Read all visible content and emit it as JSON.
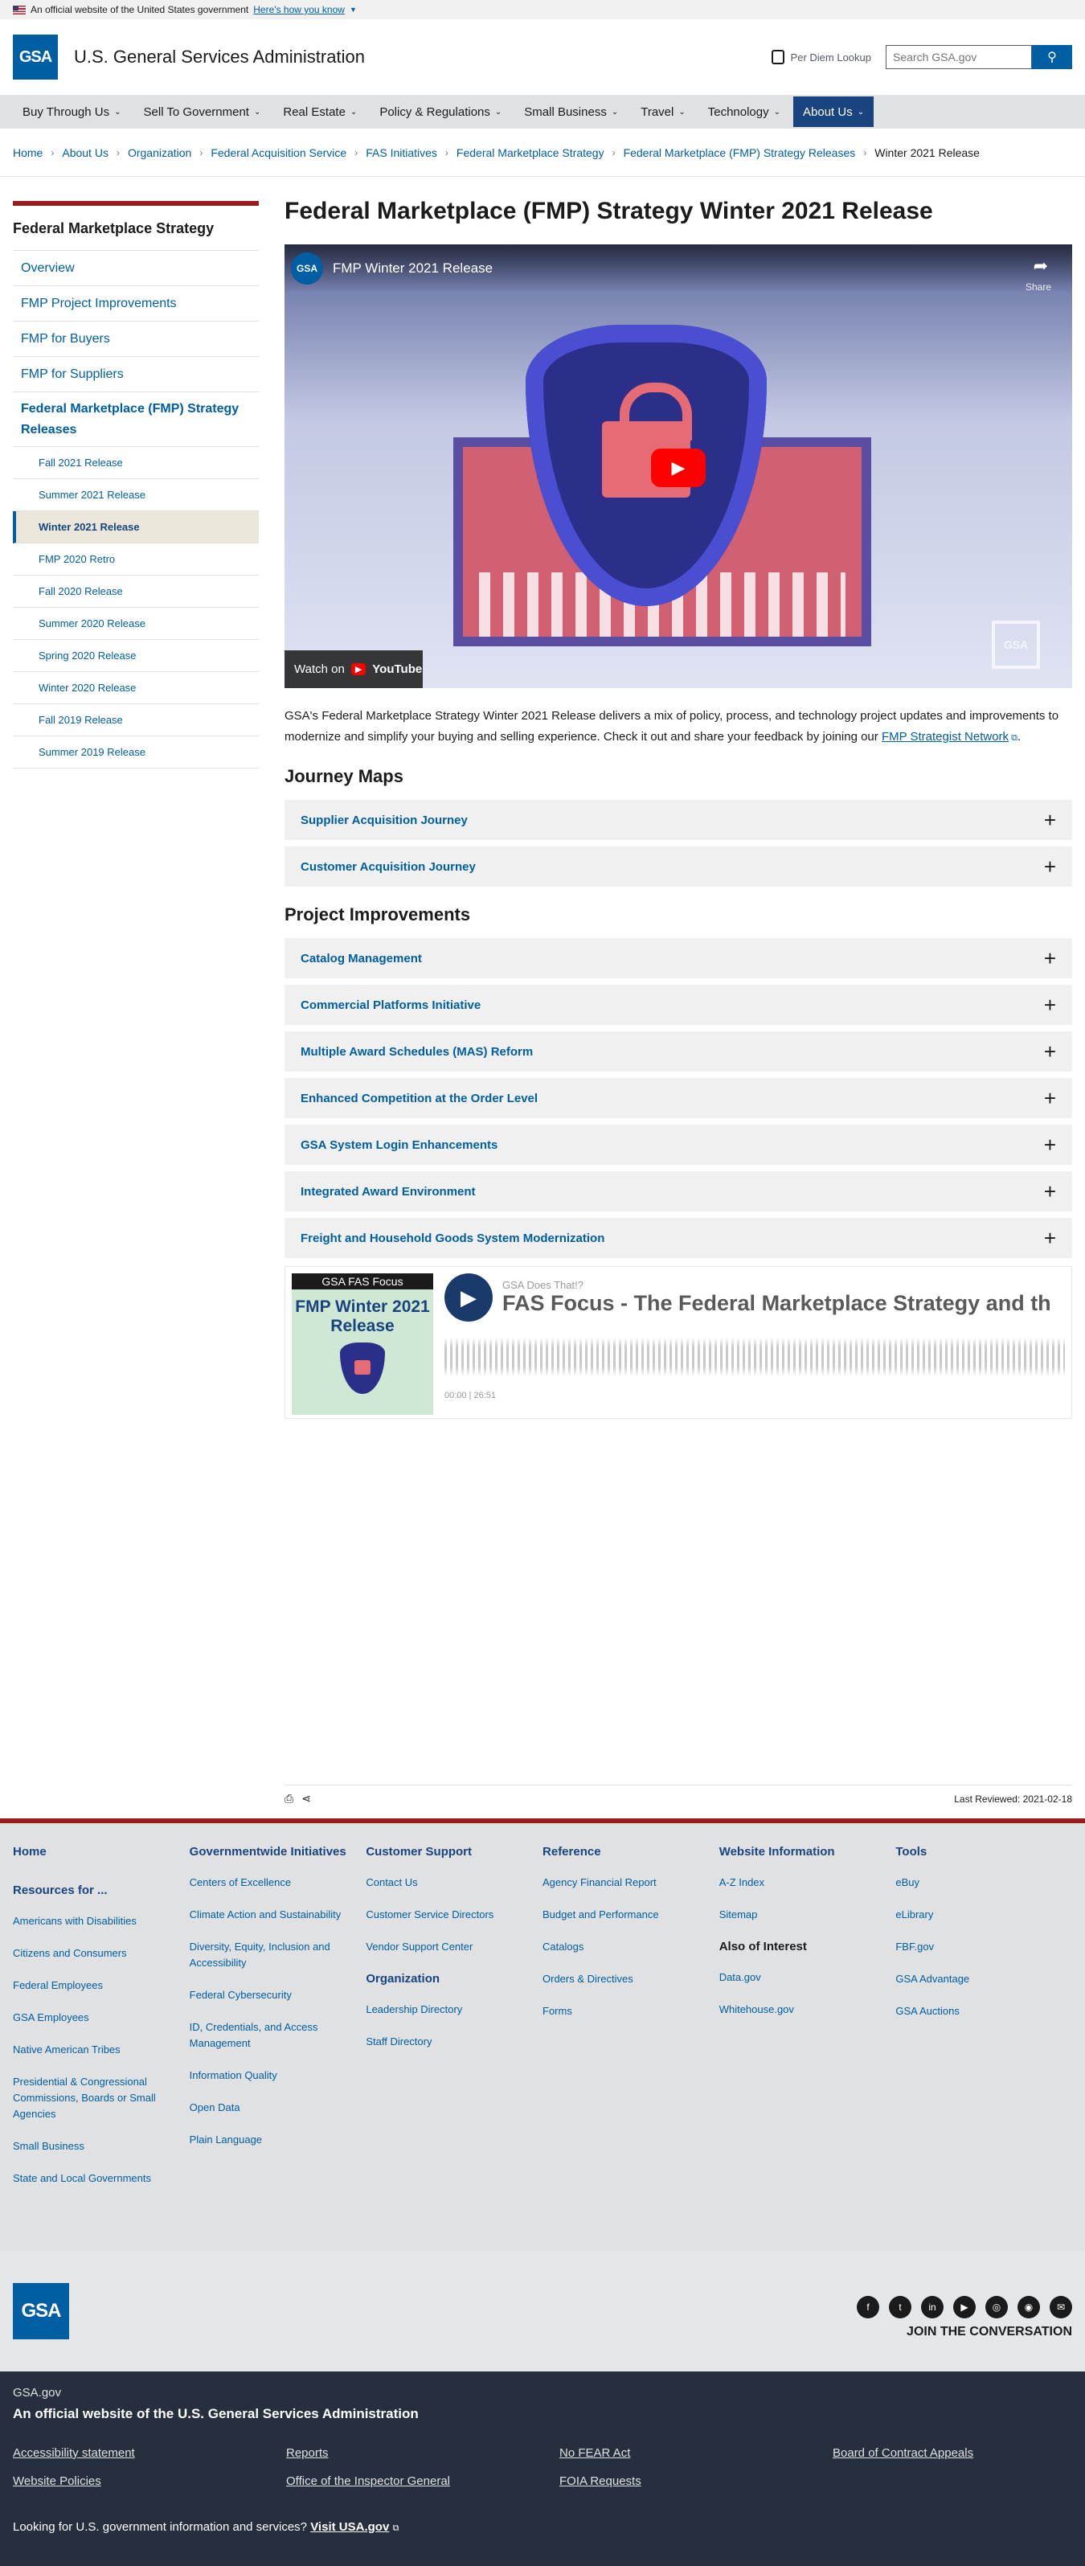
{
  "banner": {
    "text": "An official website of the United States government",
    "link": "Here's how you know"
  },
  "header": {
    "logo": "GSA",
    "title": "U.S. General Services Administration",
    "per_diem": "Per Diem Lookup",
    "search_placeholder": "Search GSA.gov",
    "search_icon": "search-icon"
  },
  "nav": {
    "items": [
      {
        "label": "Buy Through Us"
      },
      {
        "label": "Sell To Government"
      },
      {
        "label": "Real Estate"
      },
      {
        "label": "Policy & Regulations"
      },
      {
        "label": "Small Business"
      },
      {
        "label": "Travel"
      },
      {
        "label": "Technology"
      },
      {
        "label": "About Us"
      }
    ]
  },
  "breadcrumb": [
    "Home",
    "About Us",
    "Organization",
    "Federal Acquisition Service",
    "FAS Initiatives",
    "Federal Marketplace Strategy",
    "Federal Marketplace (FMP) Strategy Releases",
    "Winter 2021 Release"
  ],
  "sidenav": {
    "title": "Federal Marketplace Strategy",
    "items": [
      "Overview",
      "FMP Project Improvements",
      "FMP for Buyers",
      "FMP for Suppliers"
    ],
    "section": "Federal Marketplace (FMP) Strategy Releases",
    "sub": [
      "Fall 2021 Release",
      "Summer 2021 Release",
      "Winter 2021 Release",
      "FMP 2020 Retro",
      "Fall 2020 Release",
      "Summer 2020 Release",
      "Spring 2020 Release",
      "Winter 2020 Release",
      "Fall 2019 Release",
      "Summer 2019 Release"
    ]
  },
  "page": {
    "title": "Federal Marketplace (FMP) Strategy Winter 2021 Release",
    "intro": "GSA's Federal Marketplace Strategy Winter 2021 Release delivers a mix of policy, process, and technology project updates and improvements to modernize and simplify your buying and selling experience. Check it out and share your feedback by joining our ",
    "intro_link": "FMP Strategist Network",
    "intro_end": "."
  },
  "video": {
    "channel": "GSA",
    "title": "FMP Winter 2021 Release",
    "share": "Share",
    "watch_on": "Watch on",
    "youtube": "YouTube",
    "corner_logo": "GSA"
  },
  "journey": {
    "heading": "Journey Maps",
    "items": [
      "Supplier Acquisition Journey",
      "Customer Acquisition Journey"
    ]
  },
  "projects": {
    "heading": "Project Improvements",
    "items": [
      "Catalog Management",
      "Commercial Platforms Initiative",
      "Multiple Award Schedules (MAS) Reform",
      "Enhanced Competition at the Order Level",
      "GSA System Login Enhancements",
      "Integrated Award Environment",
      "Freight and Household Goods System Modernization"
    ]
  },
  "podcast": {
    "art_top": "GSA FAS Focus",
    "art_title": "FMP Winter 2021 Release",
    "show": "GSA Does That!?",
    "title": "FAS Focus - The Federal Marketplace Strategy and th",
    "time": "00:00 | 26:51"
  },
  "page_footer": {
    "last_reviewed": "Last Reviewed: 2021-02-18"
  },
  "footer": {
    "col1": {
      "title": "Home",
      "sub": "Resources for ...",
      "links": [
        "Americans with Disabilities",
        "Citizens and Consumers",
        "Federal Employees",
        "GSA Employees",
        "Native American Tribes",
        "Presidential & Congressional Commissions, Boards or Small Agencies",
        "Small Business",
        "State and Local Governments"
      ]
    },
    "col2": {
      "title": "Governmentwide Initiatives",
      "links": [
        "Centers of Excellence",
        "Climate Action and Sustainability",
        "Diversity, Equity, Inclusion and Accessibility",
        "Federal Cybersecurity",
        "ID, Credentials, and Access Management",
        "Information Quality",
        "Open Data",
        "Plain Language"
      ]
    },
    "col3": {
      "title": "Customer Support",
      "links": [
        "Contact Us",
        "Customer Service Directors",
        "Vendor Support Center"
      ],
      "title2": "Organization",
      "links2": [
        "Leadership Directory",
        "Staff Directory"
      ]
    },
    "col4": {
      "title": "Reference",
      "links": [
        "Agency Financial Report",
        "Budget and Performance",
        "Catalogs",
        "Orders & Directives",
        "Forms"
      ]
    },
    "col5": {
      "title": "Website Information",
      "links": [
        "A-Z Index",
        "Sitemap"
      ],
      "title2": "Also of Interest",
      "links2": [
        "Data.gov",
        "Whitehouse.gov"
      ]
    },
    "col6": {
      "title": "Tools",
      "links": [
        "eBuy",
        "eLibrary",
        "FBF.gov",
        "GSA Advantage",
        "GSA Auctions"
      ]
    },
    "logo": "GSA",
    "join": "JOIN THE CONVERSATION",
    "social": [
      "f",
      "t",
      "in",
      "▶",
      "◎",
      "◉",
      "✉"
    ],
    "gov": "GSA.gov",
    "official": "An official website of the U.S. General Services Administration",
    "links": [
      "Accessibility statement",
      "Reports",
      "No FEAR Act",
      "Board of Contract Appeals",
      "Website Policies",
      "Office of the Inspector General",
      "FOIA Requests"
    ],
    "looking": "Looking for U.S. government information and services?",
    "visit": "Visit USA.gov"
  }
}
